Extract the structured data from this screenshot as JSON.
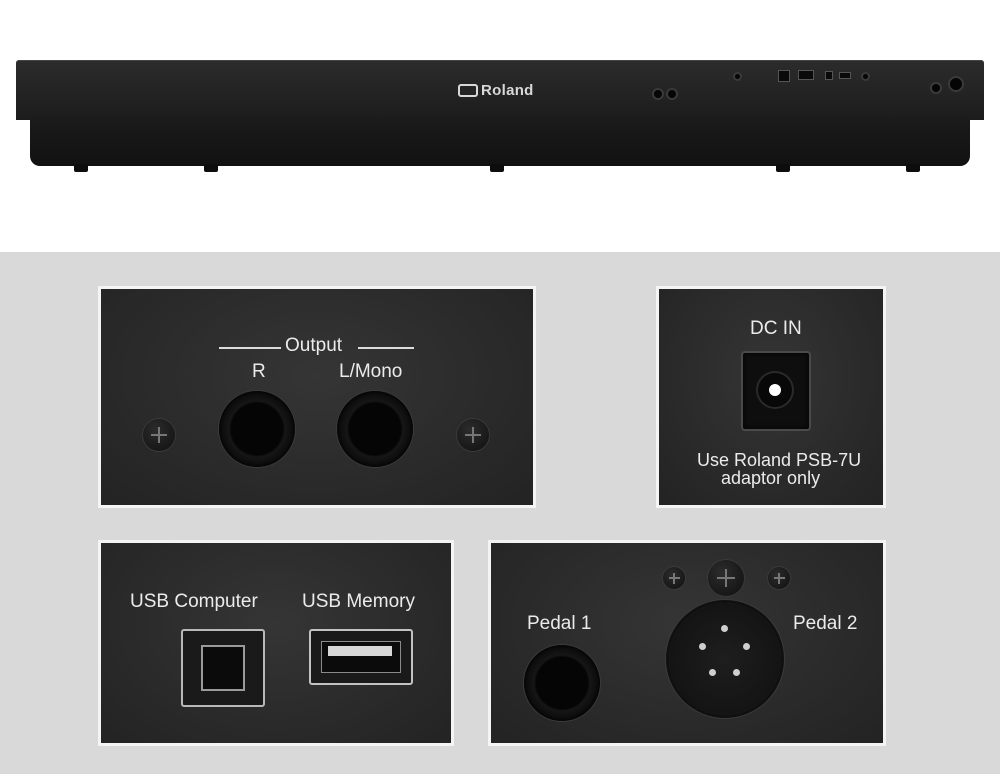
{
  "image": {
    "logo_text": "Roland",
    "colors": {
      "panel_bg": "#2a2a2a",
      "panel_border": "#f4f4f4",
      "label_text": "#ebebeb",
      "lower_background": "#d9d9d9"
    }
  },
  "panels": {
    "output": {
      "title": "Output",
      "right_label": "R",
      "left_label": "L/Mono"
    },
    "dc_in": {
      "title": "DC IN",
      "note_line1": "Use Roland PSB-7U",
      "note_line2": "adaptor only"
    },
    "usb": {
      "computer_label": "USB Computer",
      "memory_label": "USB Memory"
    },
    "pedal": {
      "pedal1_label": "Pedal 1",
      "pedal2_label": "Pedal 2"
    }
  }
}
